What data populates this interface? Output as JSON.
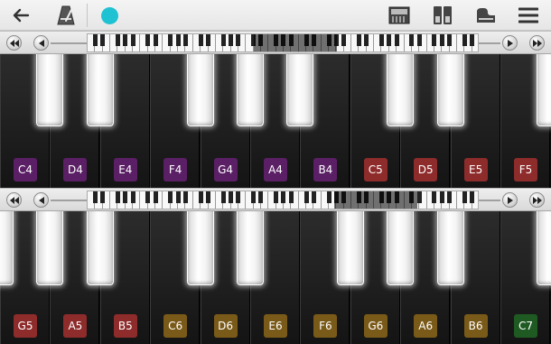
{
  "colors": {
    "accent_dot": "#1fc2d2",
    "octave4": "#5b1f66",
    "octave5": "#8e2b2b",
    "octave6": "#7a5a18",
    "octave7": "#1f5a22"
  },
  "toolbar": {
    "back_icon": "arrow-left-icon",
    "metronome_icon": "metronome-icon",
    "record_indicator_icon": "circle-icon",
    "keyboard_icon": "keyboard-icon",
    "split_icon": "split-view-icon",
    "piano_icon": "grand-piano-icon",
    "menu_icon": "hamburger-menu-icon"
  },
  "scrollbars": [
    {
      "icons": [
        "double-left-icon",
        "left-icon",
        "right-icon",
        "double-right-icon"
      ]
    },
    {
      "icons": [
        "double-left-icon",
        "left-icon",
        "right-icon",
        "double-right-icon"
      ]
    }
  ],
  "keyboard_top": {
    "keys": [
      {
        "note": "C4",
        "color": "#5b1f66"
      },
      {
        "note": "D4",
        "color": "#5b1f66"
      },
      {
        "note": "E4",
        "color": "#5b1f66"
      },
      {
        "note": "F4",
        "color": "#5b1f66"
      },
      {
        "note": "G4",
        "color": "#5b1f66"
      },
      {
        "note": "A4",
        "color": "#5b1f66"
      },
      {
        "note": "B4",
        "color": "#5b1f66"
      },
      {
        "note": "C5",
        "color": "#8e2b2b"
      },
      {
        "note": "D5",
        "color": "#8e2b2b"
      },
      {
        "note": "E5",
        "color": "#8e2b2b"
      },
      {
        "note": "F5",
        "color": "#8e2b2b"
      }
    ]
  },
  "keyboard_bottom": {
    "keys": [
      {
        "note": "G5",
        "color": "#8e2b2b"
      },
      {
        "note": "A5",
        "color": "#8e2b2b"
      },
      {
        "note": "B5",
        "color": "#8e2b2b"
      },
      {
        "note": "C6",
        "color": "#7a5a18"
      },
      {
        "note": "D6",
        "color": "#7a5a18"
      },
      {
        "note": "E6",
        "color": "#7a5a18"
      },
      {
        "note": "F6",
        "color": "#7a5a18"
      },
      {
        "note": "G6",
        "color": "#7a5a18"
      },
      {
        "note": "A6",
        "color": "#7a5a18"
      },
      {
        "note": "B6",
        "color": "#7a5a18"
      },
      {
        "note": "C7",
        "color": "#1f5a22"
      }
    ]
  }
}
